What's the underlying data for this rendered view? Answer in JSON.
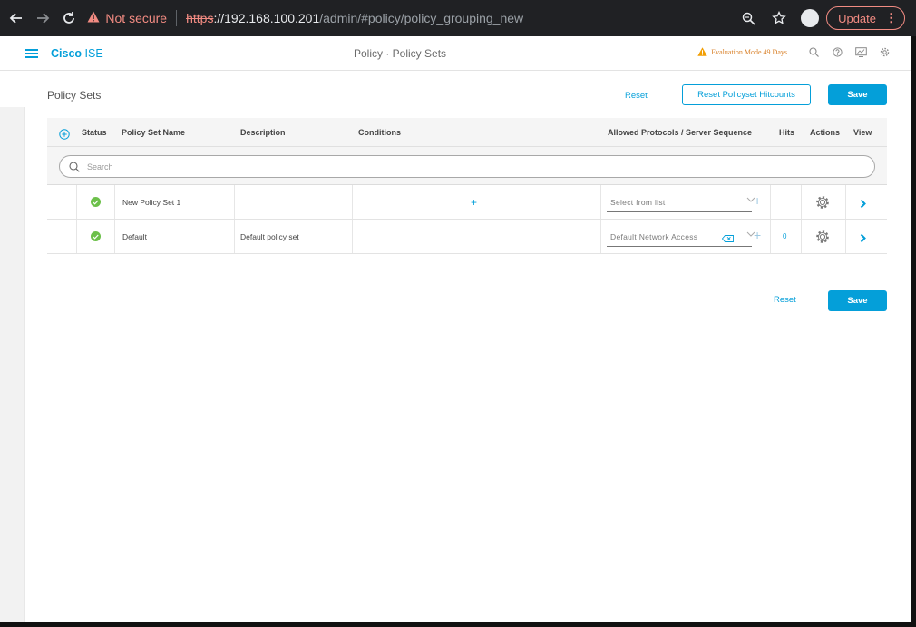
{
  "browser": {
    "warning_text": "Not secure",
    "url_scheme": "https",
    "url_host": "://192.168.100.201",
    "url_path": "/admin/#policy/policy_grouping_new",
    "update_label": "Update"
  },
  "header": {
    "brand_bold": "Cisco",
    "brand_rest": " ISE",
    "center_title": "Policy · Policy Sets",
    "evaluation": "Evaluation Mode 49 Days"
  },
  "page": {
    "title": "Policy Sets",
    "reset_label": "Reset",
    "reset_hitcounts_label": "Reset Policyset Hitcounts",
    "save_label": "Save",
    "bottom_reset_label": "Reset",
    "bottom_save_label": "Save"
  },
  "table": {
    "headers": {
      "status": "Status",
      "name": "Policy Set Name",
      "description": "Description",
      "conditions": "Conditions",
      "protocols": "Allowed Protocols / Server Sequence",
      "hits": "Hits",
      "actions": "Actions",
      "view": "View"
    },
    "search_placeholder": "Search",
    "rows": [
      {
        "name": "New Policy Set 1",
        "description": "",
        "protocol": "Select from list",
        "hits": "",
        "status": "active"
      },
      {
        "name": "Default",
        "description": "Default policy set",
        "protocol": "Default Network Access",
        "hits": "0",
        "status": "active"
      }
    ]
  },
  "colors": {
    "accent": "#049fd9",
    "status_green": "#6cc04a",
    "warning_orange": "#f29f05"
  }
}
